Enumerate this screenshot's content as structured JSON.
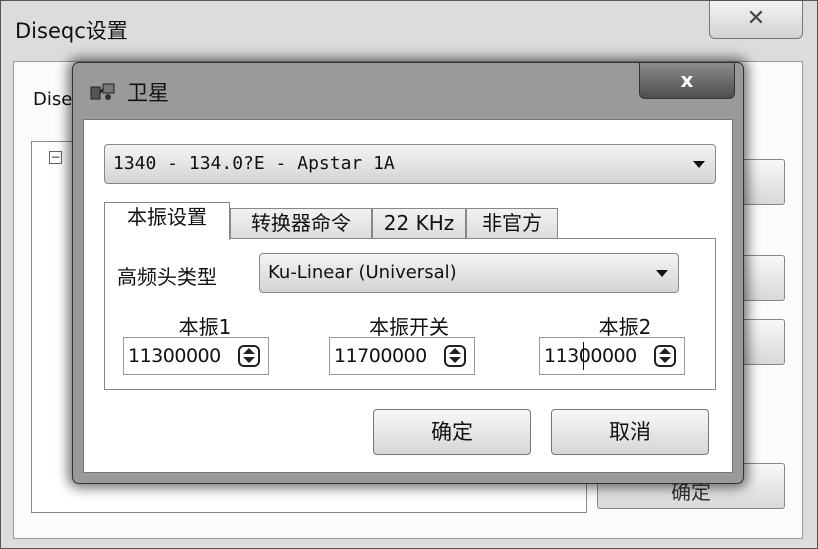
{
  "back_window": {
    "title": "Diseqc设置",
    "close_glyph": "✕",
    "label_partial": "Dise",
    "tree_toggle": "−",
    "ok_partial": "确定"
  },
  "dialog": {
    "icon": "satellite-icon",
    "title": "卫星",
    "close_glyph": "x",
    "satellite_select": "1340 - 134.0?E - Apstar 1A",
    "tabs": [
      {
        "label": "本振设置",
        "active": true
      },
      {
        "label": "转换器命令",
        "active": false
      },
      {
        "label": "22 KHz",
        "active": false
      },
      {
        "label": "非官方",
        "active": false
      }
    ],
    "lnb_type_label": "高频头类型",
    "lnb_type_value": "Ku-Linear (Universal)",
    "lof1": {
      "label": "本振1",
      "value": "11300000"
    },
    "lof_switch": {
      "label": "本振开关",
      "value": "11700000"
    },
    "lof2": {
      "label": "本振2",
      "value": "11300000"
    },
    "ok_button": "确定",
    "cancel_button": "取消"
  }
}
